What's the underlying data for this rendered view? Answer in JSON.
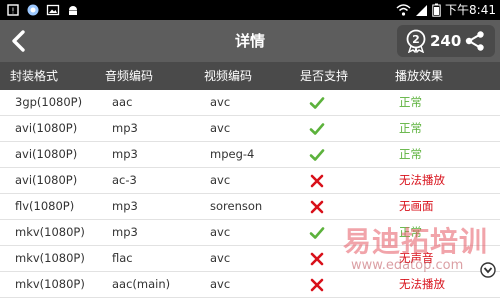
{
  "status_bar": {
    "time": "下午8:41",
    "icons": [
      "notification-icon",
      "browser-icon",
      "image-icon",
      "android-icon",
      "wifi-icon",
      "signal-icon",
      "battery-icon"
    ]
  },
  "header": {
    "title": "详情",
    "count": "240",
    "back_icon": "back-arrow-icon",
    "badge_icon": "rank-badge-icon",
    "share_icon": "share-icon"
  },
  "table": {
    "columns": [
      "封装格式",
      "音频编码",
      "视频编码",
      "是否支持",
      "播放效果"
    ],
    "rows": [
      {
        "container": "3gp(1080P)",
        "audio": "aac",
        "video": "avc",
        "supported": true,
        "effect": "正常"
      },
      {
        "container": "avi(1080P)",
        "audio": "mp3",
        "video": "avc",
        "supported": true,
        "effect": "正常"
      },
      {
        "container": "avi(1080P)",
        "audio": "mp3",
        "video": "mpeg-4",
        "supported": true,
        "effect": "正常"
      },
      {
        "container": "avi(1080P)",
        "audio": "ac-3",
        "video": "avc",
        "supported": false,
        "effect": "无法播放"
      },
      {
        "container": "flv(1080P)",
        "audio": "mp3",
        "video": "sorenson",
        "supported": false,
        "effect": "无画面"
      },
      {
        "container": "mkv(1080P)",
        "audio": "mp3",
        "video": "avc",
        "supported": true,
        "effect": "正常"
      },
      {
        "container": "mkv(1080P)",
        "audio": "flac",
        "video": "avc",
        "supported": false,
        "effect": "无声音"
      },
      {
        "container": "mkv(1080P)",
        "audio": "aac(main)",
        "video": "avc",
        "supported": false,
        "effect": "无法播放"
      }
    ]
  },
  "colors": {
    "header_bg": "#5d5d5d",
    "column_header_bg": "#4a4a4a",
    "ok": "#5cb23c",
    "bad": "#d8101a"
  },
  "watermark": {
    "text": "易迪拓培训",
    "url": "www.edatop.com"
  }
}
